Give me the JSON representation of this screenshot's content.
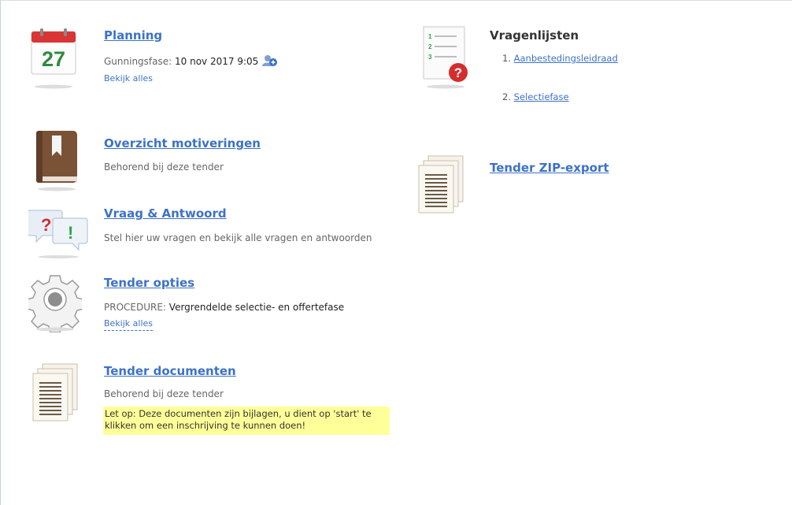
{
  "planning": {
    "title": "Planning",
    "phase_label": "Gunningsfase:",
    "phase_value": "10 nov 2017 9:05",
    "view_all": "Bekijk alles",
    "calendar_day": "27"
  },
  "motivations": {
    "title": "Overzicht motiveringen",
    "subtitle": "Behorend bij deze tender"
  },
  "qa": {
    "title": "Vraag & Antwoord",
    "subtitle": "Stel hier uw vragen en bekijk alle vragen en antwoorden"
  },
  "options": {
    "title": "Tender opties",
    "procedure_label": "PROCEDURE:",
    "procedure_value": "Vergrendelde selectie- en offertefase",
    "view_all": "Bekijk alles"
  },
  "documents": {
    "title": "Tender documenten",
    "subtitle": "Behorend bij deze tender",
    "note": "Let op: Deze documenten zijn bijlagen, u dient op 'start' te klikken om een inschrijving te kunnen doen!"
  },
  "questionnaires": {
    "title": "Vragenlijsten",
    "items": [
      {
        "num": "1.",
        "label": "Aanbestedingsleidraad"
      },
      {
        "num": "2.",
        "label": "Selectiefase"
      }
    ]
  },
  "zip_export": {
    "title": "Tender ZIP-export"
  }
}
